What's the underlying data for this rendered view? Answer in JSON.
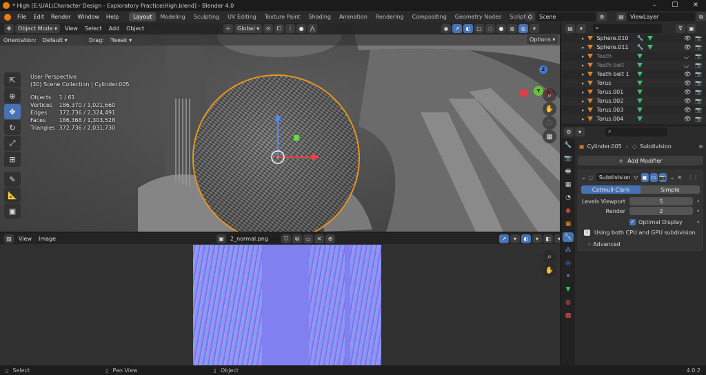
{
  "window": {
    "title": "* High [E:\\UAL\\Character Design - Exploratory Practice\\High.blend] - Blender 4.0"
  },
  "topbar": {
    "menus": [
      "File",
      "Edit",
      "Render",
      "Window",
      "Help"
    ],
    "workspaces": [
      "Layout",
      "Modeling",
      "Sculpting",
      "UV Editing",
      "Texture Paint",
      "Shading",
      "Animation",
      "Rendering",
      "Compositing",
      "Geometry Nodes",
      "Scripting"
    ],
    "active_workspace": "Layout",
    "add_tab": "+",
    "scene": "Scene",
    "view_layer": "ViewLayer"
  },
  "viewport": {
    "mode": "Object Mode",
    "menus": [
      "View",
      "Select",
      "Add",
      "Object"
    ],
    "transform_orientation": "Global",
    "tool_options": {
      "orientation_label": "Orientation:",
      "orientation_value": "Default",
      "drag_label": "Drag:",
      "drag_value": "Tweak",
      "options": "Options"
    },
    "overlay_title": "User Perspective",
    "overlay_collection": "(30) Scene Collection | Cylinder.005",
    "stats": [
      {
        "label": "Objects",
        "value": "1 / 61"
      },
      {
        "label": "Vertices",
        "value": "186,370 / 1,021,660"
      },
      {
        "label": "Edges",
        "value": "372,736 / 2,324,491"
      },
      {
        "label": "Faces",
        "value": "186,368 / 1,303,528"
      },
      {
        "label": "Triangles",
        "value": "372,736 / 2,031,730"
      }
    ],
    "gizmo_axes": {
      "x": "X",
      "y": "Y",
      "z": "Z"
    }
  },
  "image_editor": {
    "menus": [
      "View",
      "Image"
    ],
    "image_name": "2_normal.png"
  },
  "outliner": {
    "search_placeholder": "",
    "items": [
      {
        "name": "Sphere.010",
        "dim": false
      },
      {
        "name": "Sphere.011",
        "dim": false
      },
      {
        "name": "Teeth",
        "dim": true
      },
      {
        "name": "Teeth belt",
        "dim": true
      },
      {
        "name": "Teeth belt 1",
        "dim": false
      },
      {
        "name": "Torus",
        "dim": false
      },
      {
        "name": "Torus.001",
        "dim": false
      },
      {
        "name": "Torus.002",
        "dim": false
      },
      {
        "name": "Torus.003",
        "dim": false
      },
      {
        "name": "Torus.004",
        "dim": false
      }
    ]
  },
  "properties": {
    "breadcrumb_object": "Cylinder.005",
    "breadcrumb_modifier": "Subdivision",
    "add_modifier": "Add Modifier",
    "modifier": {
      "name": "Subdivision",
      "types": [
        "Catmull-Clark",
        "Simple"
      ],
      "active_type": "Catmull-Clark",
      "levels_viewport_label": "Levels Viewport",
      "levels_viewport_value": "5",
      "render_label": "Render",
      "render_value": "2",
      "optimal_display_label": "Optimal Display",
      "optimal_display_checked": true,
      "info": "Using both CPU and GPU subdivision",
      "advanced": "Advanced"
    }
  },
  "statusbar": {
    "select": "Select",
    "pan_view": "Pan View",
    "object": "Object",
    "version": "4.0.2"
  },
  "colors": {
    "accent_blue": "#4772b3",
    "selection_orange": "#e8961c",
    "mesh_orange": "#e0822c",
    "mesh_green": "#35c46b"
  }
}
